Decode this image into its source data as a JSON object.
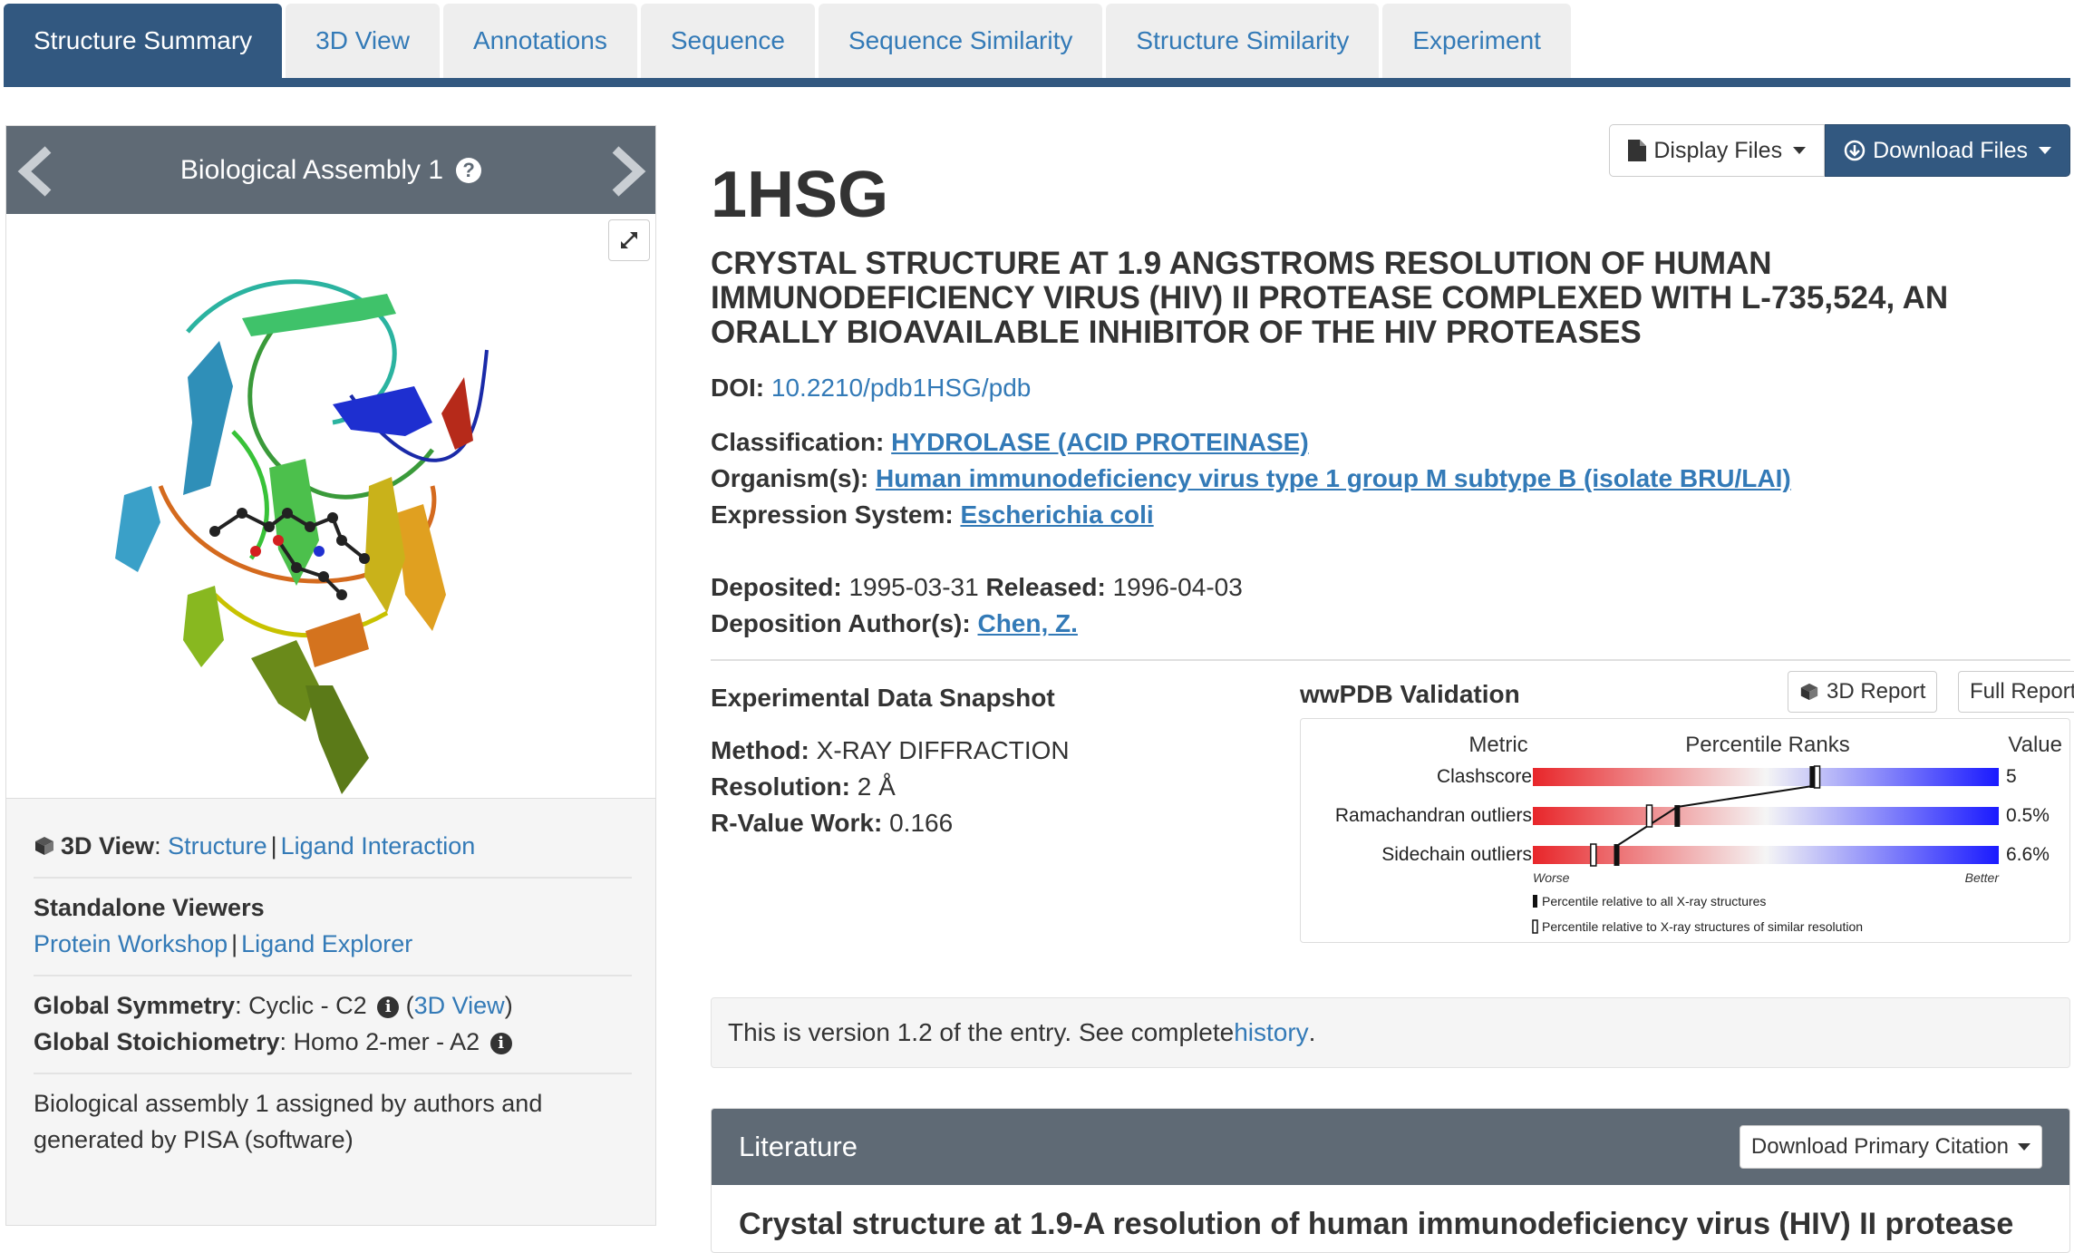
{
  "tabs": [
    {
      "label": "Structure Summary",
      "active": true
    },
    {
      "label": "3D View"
    },
    {
      "label": "Annotations"
    },
    {
      "label": "Sequence"
    },
    {
      "label": "Sequence Similarity"
    },
    {
      "label": "Structure Similarity"
    },
    {
      "label": "Experiment"
    }
  ],
  "assembly": {
    "title": "Biological Assembly 1",
    "help": "?"
  },
  "left": {
    "view3d_label": "3D View",
    "view3d_links": [
      "Structure",
      "Ligand Interaction"
    ],
    "standalone_title": "Standalone Viewers",
    "standalone_links": [
      "Protein Workshop",
      "Ligand Explorer"
    ],
    "symmetry_label": "Global Symmetry",
    "symmetry_value": "Cyclic - C2",
    "symmetry_link": "3D View",
    "stoich_label": "Global Stoichiometry",
    "stoich_value": "Homo 2-mer - A2",
    "assembly_note": "Biological assembly 1 assigned by authors and generated by PISA (software)"
  },
  "header_buttons": {
    "display": "Display Files",
    "download": "Download Files"
  },
  "entry": {
    "id": "1HSG",
    "title": "CRYSTAL STRUCTURE AT 1.9 ANGSTROMS RESOLUTION OF HUMAN IMMUNODEFICIENCY VIRUS (HIV) II PROTEASE COMPLEXED WITH L-735,524, AN ORALLY BIOAVAILABLE INHIBITOR OF THE HIV PROTEASES",
    "doi_label": "DOI:",
    "doi": "10.2210/pdb1HSG/pdb",
    "classification_label": "Classification:",
    "classification": "HYDROLASE (ACID PROTEINASE)",
    "organism_label": "Organism(s):",
    "organism": "Human immunodeficiency virus type 1 group M subtype B (isolate BRU/LAI)",
    "expression_label": "Expression System:",
    "expression": "Escherichia coli",
    "deposited_label": "Deposited:",
    "deposited": "1995-03-31",
    "released_label": "Released:",
    "released": "1996-04-03",
    "authors_label": "Deposition Author(s):",
    "authors": "Chen, Z."
  },
  "snapshot": {
    "title": "Experimental Data Snapshot",
    "method_label": "Method:",
    "method": "X-RAY DIFFRACTION",
    "resolution_label": "Resolution:",
    "resolution": "2 Å",
    "rvalue_label": "R-Value Work:",
    "rvalue": "0.166"
  },
  "validation": {
    "title": "wwPDB Validation",
    "report3d": "3D Report",
    "full_report": "Full Report",
    "headers": {
      "metric": "Metric",
      "ranks": "Percentile Ranks",
      "value": "Value"
    },
    "metrics": [
      {
        "name": "Clashscore",
        "value": "5",
        "all_pct": 0.6,
        "sim_pct": 0.61
      },
      {
        "name": "Ramachandran outliers",
        "value": "0.5%",
        "all_pct": 0.31,
        "sim_pct": 0.25
      },
      {
        "name": "Sidechain outliers",
        "value": "6.6%",
        "all_pct": 0.18,
        "sim_pct": 0.13
      }
    ],
    "worse": "Worse",
    "better": "Better",
    "legend_all": "Percentile relative to all X-ray structures",
    "legend_similar": "Percentile relative to X-ray structures of similar resolution",
    "colors": {
      "worse": "#e8262a",
      "mid": "#f5f5f5",
      "better": "#1a1aff"
    }
  },
  "version": {
    "text": "This is version 1.2 of the entry. See complete ",
    "link": "history",
    "end": "."
  },
  "literature": {
    "title": "Literature",
    "download": "Download Primary Citation",
    "citation": "Crystal structure at 1.9-A resolution of human immunodeficiency virus (HIV) II protease"
  }
}
